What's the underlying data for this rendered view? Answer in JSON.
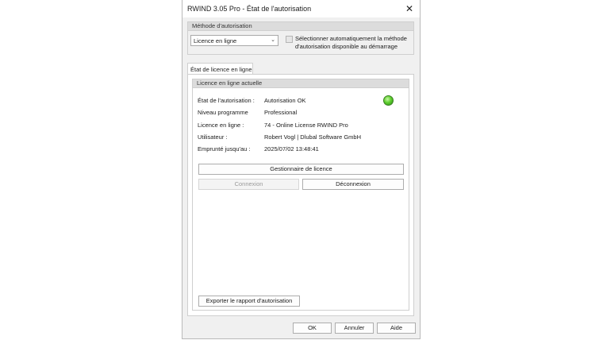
{
  "window": {
    "title": "RWIND 3.05 Pro - État de l'autorisation"
  },
  "auth_method": {
    "group_label": "Méthode d'autorisation",
    "selected": "Licence en ligne",
    "auto_select_label": "Sélectionner automatiquement la méthode d'autorisation disponible au démarrage",
    "auto_select_checked": false
  },
  "tabs": [
    {
      "label": "État de licence en ligne",
      "active": true
    }
  ],
  "license": {
    "group_label": "Licence en ligne actuelle",
    "status_color": "#4cc42a",
    "rows": [
      {
        "key": "État de l'autorisation :",
        "value": "Autorisation OK"
      },
      {
        "key": "Niveau programme",
        "value": "Professional"
      },
      {
        "key": "Licence en ligne :",
        "value": "74 - Online License RWIND Pro"
      },
      {
        "key": "Utilisateur :",
        "value": "Robert Vogl | Dlubal Software GmbH"
      },
      {
        "key": "Emprunté jusqu'au :",
        "value": "2025/07/02 13:48:41"
      }
    ],
    "manager_button": "Gestionnaire de licence",
    "connect_button": "Connexion",
    "disconnect_button": "Déconnexion",
    "export_button": "Exporter le rapport d'autorisation"
  },
  "footer": {
    "ok": "OK",
    "cancel": "Annuler",
    "help": "Aide"
  }
}
